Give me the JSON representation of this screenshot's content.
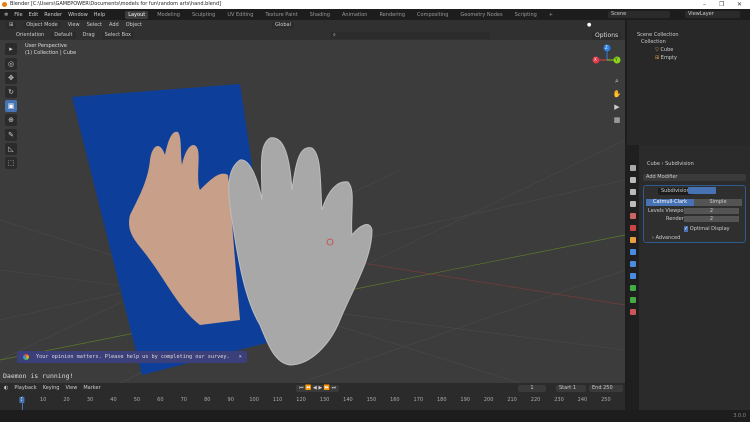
{
  "title": "Blender [C:\\Users\\GAMEPOWER\\Documents\\models for fun\\random arts\\hand.blend]",
  "window_controls": [
    "–",
    "❐",
    "✕"
  ],
  "menu": [
    "File",
    "Edit",
    "Render",
    "Window",
    "Help"
  ],
  "workspaces": [
    "Layout",
    "Modeling",
    "Sculpting",
    "UV Editing",
    "Texture Paint",
    "Shading",
    "Animation",
    "Rendering",
    "Compositing",
    "Geometry Nodes",
    "Scripting",
    "+"
  ],
  "scene": "Scene",
  "view_layer": "ViewLayer",
  "viewport": {
    "mode": "Object Mode",
    "menus": [
      "View",
      "Select",
      "Add",
      "Object"
    ],
    "transform": "Global",
    "orientation_label": "Orientation",
    "orientation": "Default",
    "drag_label": "Drag",
    "drag": "Select Box",
    "options": "Options",
    "perspective": "User Perspective",
    "collection_info": "(1) Collection | Cube",
    "gizmo": {
      "z": "Z",
      "y": "Y",
      "x": "X"
    }
  },
  "outliner": {
    "items": [
      "Scene Collection",
      "Collection",
      "Cube",
      "Empty"
    ]
  },
  "properties": {
    "breadcrumb_object": "Cube",
    "breadcrumb_modifier": "Subdivision",
    "add_modifier": "Add Modifier",
    "modifier_name": "Subdivision",
    "type_options": [
      "Catmull-Clark",
      "Simple"
    ],
    "levels_viewport_label": "Levels Viewport",
    "levels_viewport": "2",
    "render_label": "Render",
    "render": "2",
    "optimal_display": "Optimal Display",
    "advanced": "Advanced"
  },
  "toast": {
    "text": "Your opinion matters. Please help us by completing our survey.",
    "close": "×"
  },
  "daemon": "Daemon is running!",
  "timeline": {
    "menus": [
      "Playback",
      "Keying",
      "View",
      "Marker"
    ],
    "current_frame": "1",
    "start_label": "Start",
    "start": "1",
    "end_label": "End",
    "end": "250",
    "ticks": [
      "1",
      "10",
      "20",
      "30",
      "40",
      "50",
      "60",
      "70",
      "80",
      "90",
      "100",
      "110",
      "120",
      "130",
      "140",
      "150",
      "160",
      "170",
      "180",
      "190",
      "200",
      "210",
      "220",
      "230",
      "240",
      "250"
    ]
  },
  "version": "3.0.0",
  "colors": {
    "accent": "#4772b3",
    "plane": "#0d3f9a",
    "viewport": "#3c3c3c"
  }
}
